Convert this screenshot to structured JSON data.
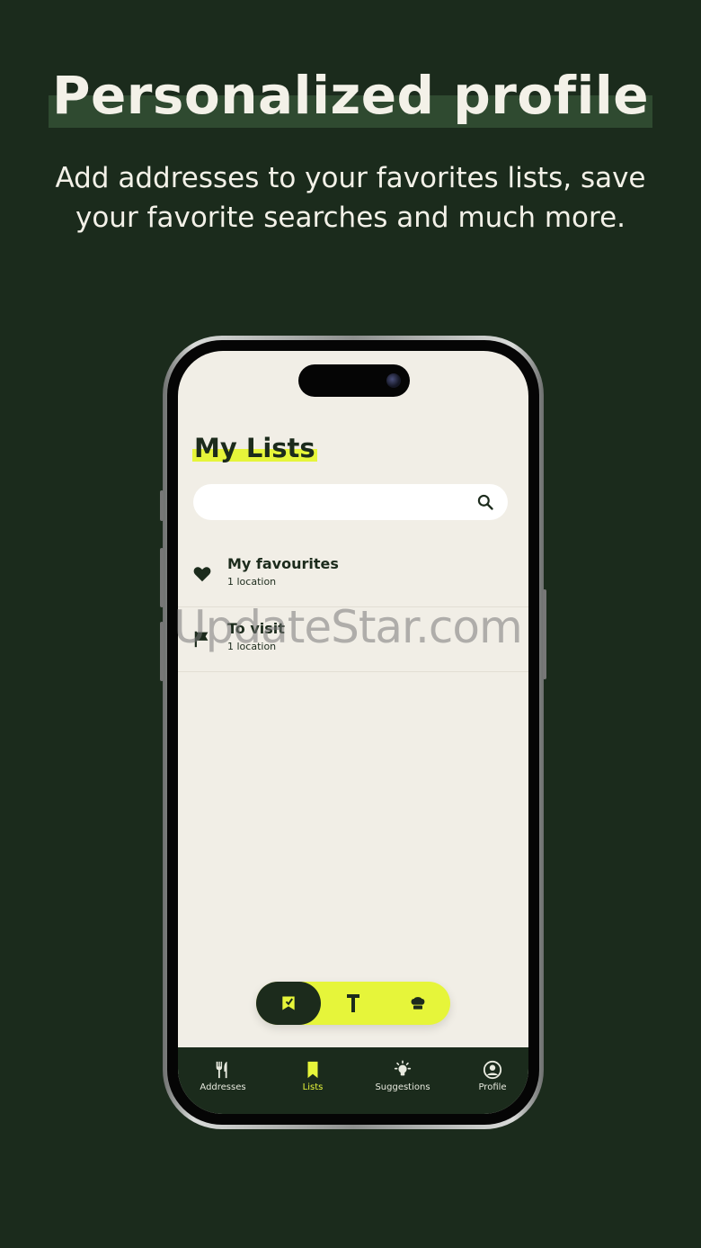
{
  "promo": {
    "title": "Personalized profile",
    "subtitle": "Add addresses to your favorites lists, save your favorite searches and much more."
  },
  "screen": {
    "title": "My Lists",
    "search": {
      "value": "",
      "icon": "search-icon"
    },
    "lists": [
      {
        "name": "My favourites",
        "meta": "1 location",
        "icon": "heart-icon"
      },
      {
        "name": "To visit",
        "meta": "1 location",
        "icon": "flag-icon"
      }
    ],
    "toggle": [
      {
        "icon": "checked-flag-icon",
        "active": true
      },
      {
        "icon": "fork-icon",
        "active": false
      },
      {
        "icon": "chef-hat-icon",
        "active": false
      }
    ],
    "tabs": [
      {
        "label": "Addresses",
        "icon": "cutlery-icon"
      },
      {
        "label": "Lists",
        "icon": "bookmark-icon",
        "active": true
      },
      {
        "label": "Suggestions",
        "icon": "lightbulb-icon"
      },
      {
        "label": "Profile",
        "icon": "user-circle-icon"
      }
    ]
  },
  "watermark": "UpdateStar.com",
  "colors": {
    "background": "#1b2b1c",
    "accent": "#e6f53a",
    "screen": "#f1eee6"
  }
}
